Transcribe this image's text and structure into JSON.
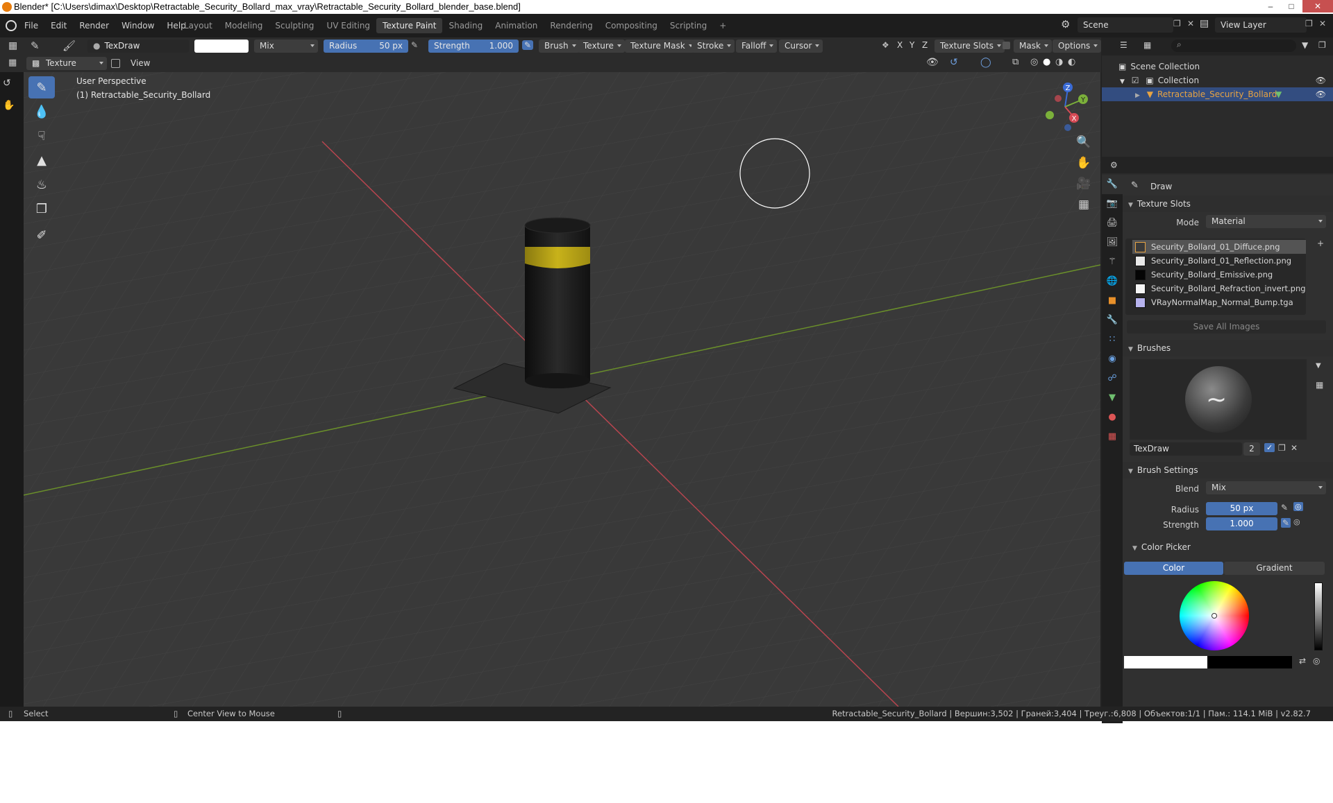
{
  "window": {
    "title": "Blender* [C:\\Users\\dimax\\Desktop\\Retractable_Security_Bollard_max_vray\\Retractable_Security_Bollard_blender_base.blend]"
  },
  "menu": [
    "File",
    "Edit",
    "Render",
    "Window",
    "Help"
  ],
  "workspaces": [
    "Layout",
    "Modeling",
    "Sculpting",
    "UV Editing",
    "Texture Paint",
    "Shading",
    "Animation",
    "Rendering",
    "Compositing",
    "Scripting"
  ],
  "active_workspace": "Texture Paint",
  "scene": "Scene",
  "view_layer": "View Layer",
  "tool_header": {
    "brush_name": "TexDraw",
    "blend": "Mix",
    "radius_label": "Radius",
    "radius_value": "50 px",
    "strength_label": "Strength",
    "strength_value": "1.000",
    "menus": [
      "Brush",
      "Texture",
      "Texture Mask",
      "Stroke",
      "Falloff",
      "Cursor"
    ],
    "axes": [
      "X",
      "Y",
      "Z"
    ],
    "texture_slots": "Texture Slots",
    "mask": "Mask",
    "options": "Options"
  },
  "viewport_header": {
    "mode": "Texture Paint",
    "view": "View"
  },
  "viewport": {
    "perspective": "User Perspective",
    "object": "(1) Retractable_Security_Bollard",
    "gizmo": {
      "x": "X",
      "y": "Y",
      "z": "Z"
    }
  },
  "outliner": {
    "root": "Scene Collection",
    "collection": "Collection",
    "object": "Retractable_Security_Bollard"
  },
  "properties": {
    "tool_name": "Draw",
    "texture_slots": {
      "title": "Texture Slots",
      "mode_label": "Mode",
      "mode_value": "Material",
      "slots": [
        {
          "name": "Security_Bollard_01_Diffuce.png",
          "color": "#3a3a3a"
        },
        {
          "name": "Security_Bollard_01_Reflection.png",
          "color": "#e8e8e8"
        },
        {
          "name": "Security_Bollard_Emissive.png",
          "color": "#050505"
        },
        {
          "name": "Security_Bollard_Refraction_invert.png",
          "color": "#f5f5f5"
        },
        {
          "name": "VRayNormalMap_Normal_Bump.tga",
          "color": "#b7b3ee"
        }
      ],
      "save_all": "Save All Images"
    },
    "brushes": {
      "title": "Brushes",
      "name": "TexDraw",
      "users": "2"
    },
    "brush_settings": {
      "title": "Brush Settings",
      "blend_label": "Blend",
      "blend_value": "Mix",
      "radius_label": "Radius",
      "radius_value": "50 px",
      "strength_label": "Strength",
      "strength_value": "1.000"
    },
    "color_picker": {
      "title": "Color Picker",
      "tab_color": "Color",
      "tab_gradient": "Gradient"
    }
  },
  "statusbar": {
    "select": "Select",
    "center_view": "Center View to Mouse",
    "stats": "Retractable_Security_Bollard | Вершин:3,502 | Граней:3,404 | Треуг.:6,808 | Объектов:1/1 | Пам.: 114.1 MiB | v2.82.7"
  },
  "colors": {
    "accent": "#4772b3",
    "selection": "#334d80",
    "object_name": "#e7a343",
    "bollard_stripe": "#c8b21a"
  }
}
